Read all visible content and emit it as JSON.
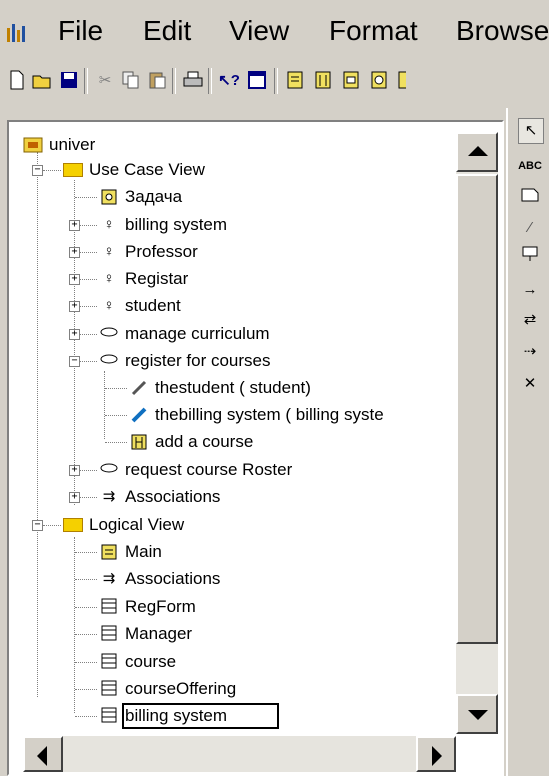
{
  "menu": [
    "File",
    "Edit",
    "View",
    "Format",
    "Browse"
  ],
  "toolbar_icons": [
    "new-icon",
    "open-icon",
    "save-icon",
    "cut-icon",
    "copy-icon",
    "paste-icon",
    "print-icon",
    "context-help-icon",
    "view-doc-icon",
    "browse-class-diagram-icon",
    "browse-interaction-diagram-icon",
    "browse-component-diagram-icon",
    "browse-deployment-diagram-icon"
  ],
  "tree": {
    "root": "univer",
    "use_case_view": {
      "label": "Use Case View",
      "items": [
        {
          "label": "Задача",
          "icon": "diagram-icon"
        },
        {
          "label": "billing system",
          "icon": "actor-icon"
        },
        {
          "label": "Professor",
          "icon": "actor-icon"
        },
        {
          "label": "Registar",
          "icon": "actor-icon"
        },
        {
          "label": "student",
          "icon": "actor-icon"
        },
        {
          "label": "manage curriculum",
          "icon": "use-case-icon"
        },
        {
          "label": "register for courses",
          "icon": "use-case-icon"
        },
        {
          "label": "thestudent ( student)",
          "icon": "association-icon"
        },
        {
          "label": "thebilling system ( billing syste",
          "icon": "association-icon"
        },
        {
          "label": "add a course",
          "icon": "sequence-diagram-icon"
        },
        {
          "label": "request course Roster",
          "icon": "use-case-icon"
        },
        {
          "label": "Associations",
          "icon": "associations-icon"
        }
      ]
    },
    "logical_view": {
      "label": "Logical View",
      "items": [
        {
          "label": "Main",
          "icon": "diagram-icon"
        },
        {
          "label": "Associations",
          "icon": "associations-icon"
        },
        {
          "label": "RegForm",
          "icon": "class-icon"
        },
        {
          "label": "Manager",
          "icon": "class-icon"
        },
        {
          "label": "course",
          "icon": "class-icon"
        },
        {
          "label": "courseOffering",
          "icon": "class-icon"
        },
        {
          "label": "billing system",
          "icon": "class-icon"
        }
      ]
    }
  },
  "toolbox": [
    "selection-arrow-icon",
    "text-box-icon",
    "note-icon",
    "anchor-note-icon",
    "package-icon",
    "unidirectional-association-icon",
    "dependency-icon",
    "generalization-icon",
    "close-icon"
  ],
  "toolbox_text": {
    "abc": "ABC"
  }
}
